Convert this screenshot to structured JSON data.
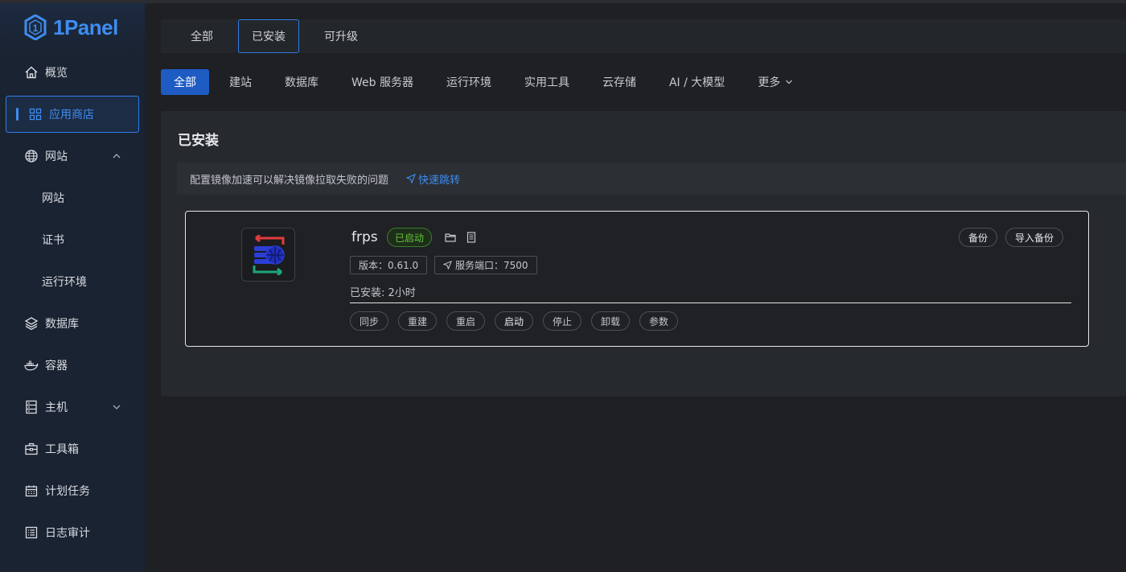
{
  "brand": {
    "name": "1Panel",
    "color": "#3f8df0"
  },
  "sidebar": {
    "items": [
      {
        "label": "概览",
        "icon": "home-icon"
      },
      {
        "label": "应用商店",
        "icon": "grid-icon",
        "active": true
      },
      {
        "label": "网站",
        "icon": "globe-icon",
        "expanded": true
      },
      {
        "label": "网站",
        "sub": true
      },
      {
        "label": "证书",
        "sub": true
      },
      {
        "label": "运行环境",
        "sub": true
      },
      {
        "label": "数据库",
        "icon": "layers-icon"
      },
      {
        "label": "容器",
        "icon": "docker-icon"
      },
      {
        "label": "主机",
        "icon": "server-icon",
        "collapsed": true
      },
      {
        "label": "工具箱",
        "icon": "toolbox-icon"
      },
      {
        "label": "计划任务",
        "icon": "calendar-icon"
      },
      {
        "label": "日志审计",
        "icon": "log-icon"
      }
    ]
  },
  "top_tabs": [
    {
      "label": "全部"
    },
    {
      "label": "已安装",
      "active": true
    },
    {
      "label": "可升级"
    }
  ],
  "categories": [
    {
      "label": "全部",
      "active": true
    },
    {
      "label": "建站"
    },
    {
      "label": "数据库"
    },
    {
      "label": "Web 服务器"
    },
    {
      "label": "运行环境"
    },
    {
      "label": "实用工具"
    },
    {
      "label": "云存储"
    },
    {
      "label": "AI / 大模型"
    },
    {
      "label": "更多"
    }
  ],
  "panel": {
    "title": "已安装",
    "notice": "配置镜像加速可以解决镜像拉取失败的问题",
    "notice_link": "快速跳转"
  },
  "app": {
    "name": "frps",
    "status": "已启动",
    "version": "版本：0.61.0",
    "port": "服务端口：7500",
    "installed": "已安装:   2小时",
    "backup_label": "备份",
    "import_backup_label": "导入备份",
    "actions": [
      "同步",
      "重建",
      "重启",
      "启动",
      "停止",
      "卸载",
      "参数"
    ]
  },
  "colors": {
    "accent": "#3f8df0",
    "active_category_bg": "#1e5cc4",
    "status_green": "#67c23a"
  }
}
